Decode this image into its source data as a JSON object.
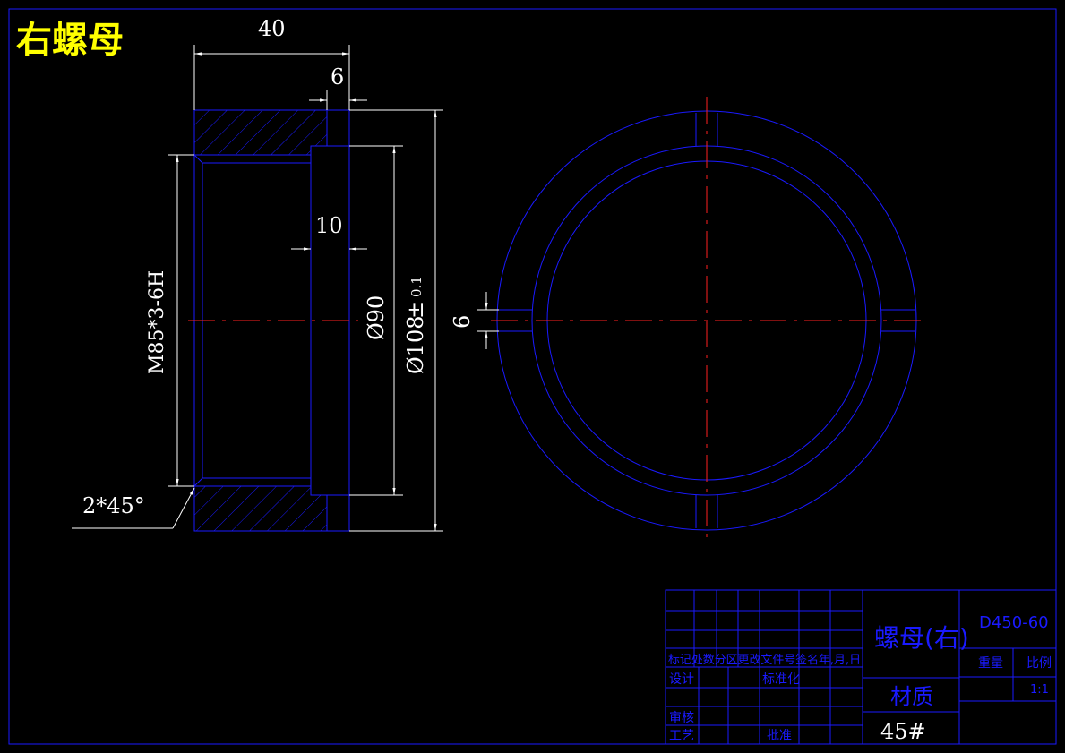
{
  "drawing_title": "右螺母",
  "dimensions": {
    "width_total": "40",
    "groove_width": "6",
    "recess_depth": "10",
    "thread": "M85*3-6H",
    "bore": "Ø90",
    "outer": "Ø108",
    "tolerance": "±",
    "tolerance_value": "0.1",
    "chamfer": "2*45°",
    "slot_width": "6"
  },
  "title_block": {
    "part_name": "螺母(右)",
    "drawing_number": "D450-60",
    "material_label": "材质",
    "material": "45#",
    "weight_label": "重量",
    "scale_label": "比例",
    "scale": "1:1",
    "header_row": "标记处数分区更改文件号签名年,月,日",
    "design": "设计",
    "standardization": "标准化",
    "review": "审核",
    "process": "工艺",
    "approve": "批准"
  },
  "colors": {
    "geometry": "#1a1aff",
    "dimension": "#ffffff",
    "centerline": "#ff2020",
    "title": "#ffff00"
  }
}
